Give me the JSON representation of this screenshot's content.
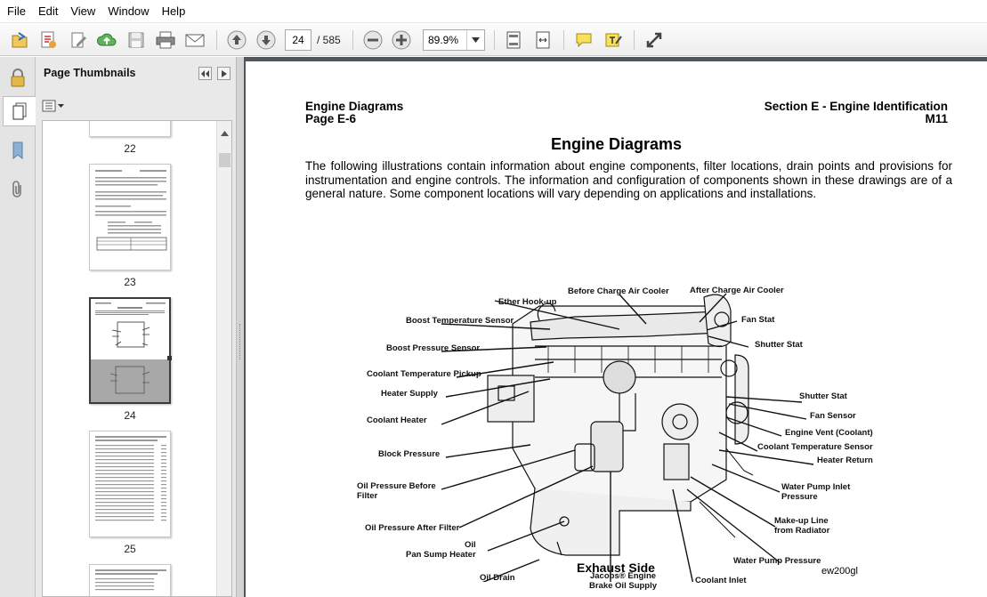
{
  "menu": [
    "File",
    "Edit",
    "View",
    "Window",
    "Help"
  ],
  "toolbar": {
    "current_page": "24",
    "page_total": "/ 585",
    "zoom": "89.9%"
  },
  "sidebar": {
    "title": "Page Thumbnails"
  },
  "thumbnails": [
    {
      "label": "22"
    },
    {
      "label": "23"
    },
    {
      "label": "24",
      "selected": true
    },
    {
      "label": "25"
    }
  ],
  "document": {
    "header_left_1": "Engine Diagrams",
    "header_left_2": "Page E-6",
    "header_right_1": "Section E - Engine Identification",
    "header_right_2": "M11",
    "title": "Engine Diagrams",
    "intro": "The following illustrations contain information about engine components, filter locations, drain points and provisions for instrumentation and engine controls. The information and configuration of components shown in these drawings are of a general nature. Some component locations will vary depending on applications and installations.",
    "caption": "Exhaust Side",
    "figure_id": "ew200gl"
  },
  "callouts": [
    "Ether Hook-up",
    "Before Charge Air Cooler",
    "After Charge Air Cooler",
    "Boost Temperature Sensor",
    "Fan Stat",
    "Shutter Stat",
    "Boost Pressure Sensor",
    "Coolant Temperature Pickup",
    "Heater Supply",
    "Shutter Stat",
    "Fan Sensor",
    "Coolant Heater",
    "Engine Vent (Coolant)",
    "Coolant Temperature Sensor",
    "Block Pressure",
    "Heater Return",
    "Oil Pressure Before\nFilter",
    "Water Pump Inlet\nPressure",
    "Make-up Line\nfrom Radiator",
    "Oil Pressure After Filter",
    "Oil\nPan Sump Heater",
    "Water Pump Pressure",
    "Oil Drain",
    "Jacobs® Engine\nBrake Oil Supply",
    "Coolant Inlet"
  ],
  "colors": {
    "doc_background": "#525659",
    "panel_background": "#e9e9e9",
    "toolbar_background": "#f2f2f2"
  }
}
